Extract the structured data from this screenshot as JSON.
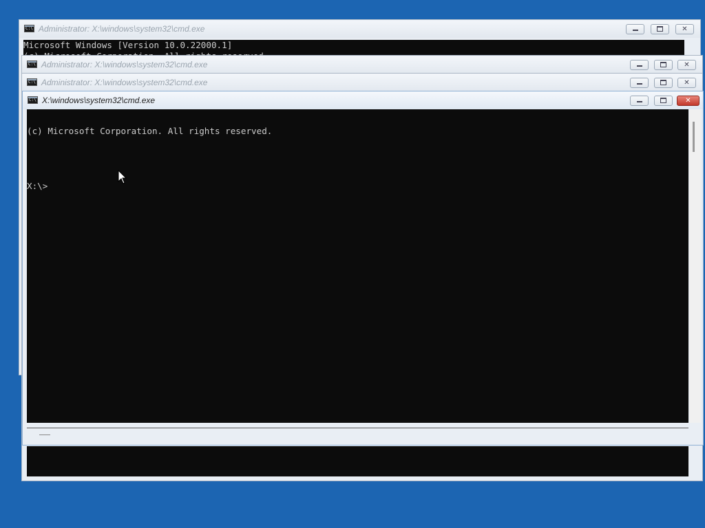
{
  "windows": {
    "back": {
      "title": "Administrator: X:\\windows\\system32\\cmd.exe",
      "icon": "cmd-icon",
      "lines": [
        "Microsoft Windows [Version 10.0.22000.1]",
        "(c) Microsoft Corporation. All rights reserved."
      ]
    },
    "middle1": {
      "title": "Administrator: X:\\windows\\system32\\cmd.exe",
      "icon": "cmd-icon"
    },
    "middle2": {
      "title": "Administrator: X:\\windows\\system32\\cmd.exe",
      "icon": "cmd-icon"
    },
    "front": {
      "title": "X:\\windows\\system32\\cmd.exe",
      "icon": "cmd-icon",
      "lines": [
        "(c) Microsoft Corporation. All rights reserved.",
        "",
        "X:\\>"
      ]
    }
  },
  "controls": {
    "minimize": "minimize-icon",
    "maximize": "maximize-icon",
    "close": "close-icon"
  },
  "colors": {
    "desktop": "#1c65b2",
    "console_bg": "#0c0c0c",
    "console_text": "#cccccc",
    "close_button": "#c2382b"
  }
}
